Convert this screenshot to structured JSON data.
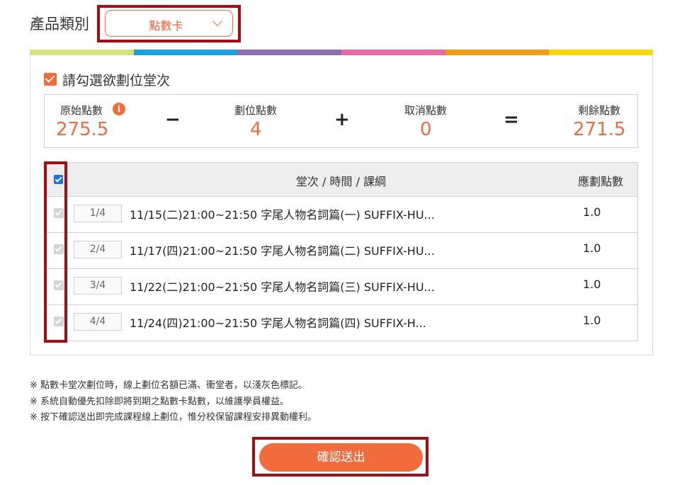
{
  "category": {
    "label": "產品類別",
    "selected": "點數卡"
  },
  "stripe_colors": [
    "#d6e27c",
    "#1aa1e1",
    "#8f6eae",
    "#e86aa0",
    "#f39c11",
    "#fcd803"
  ],
  "panel": {
    "select_text": "請勾選欲劃位堂次",
    "points": {
      "original_label": "原始點數",
      "original_value": "275.5",
      "info_glyph": "i",
      "minus": "−",
      "booked_label": "劃位點數",
      "booked_value": "4",
      "plus": "+",
      "cancel_label": "取消點數",
      "cancel_value": "0",
      "equals": "=",
      "remaining_label": "剩餘點數",
      "remaining_value": "271.5"
    },
    "table": {
      "header_center": "堂次 / 時間 / 課綱",
      "header_points": "應劃點數",
      "rows": [
        {
          "seq": "1/4",
          "desc": "11/15(二)21:00~21:50   字尾人物名詞篇(一) SUFFIX-HU...",
          "points": "1.0"
        },
        {
          "seq": "2/4",
          "desc": "11/17(四)21:00~21:50   字尾人物名詞篇(二) SUFFIX-HU...",
          "points": "1.0"
        },
        {
          "seq": "3/4",
          "desc": "11/22(二)21:00~21:50   字尾人物名詞篇(三) SUFFIX-HU...",
          "points": "1.0"
        },
        {
          "seq": "4/4",
          "desc": "11/24(四)21:00~21:50   字尾人物名詞篇(四) SUFFIX-H...",
          "points": "1.0"
        }
      ]
    }
  },
  "notes": [
    "※ 點數卡堂次劃位時，線上劃位名額已滿、衝堂者，以淺灰色標記。",
    "※ 系統自動優先扣除即將到期之點數卡點數，以維護學員權益。",
    "※ 按下確認送出即完成課程線上劃位，惟分校保留課程安排異動權利。"
  ],
  "submit_label": "確認送出",
  "colors": {
    "accent": "#f26b3a",
    "highlight_border": "#a80c12"
  }
}
